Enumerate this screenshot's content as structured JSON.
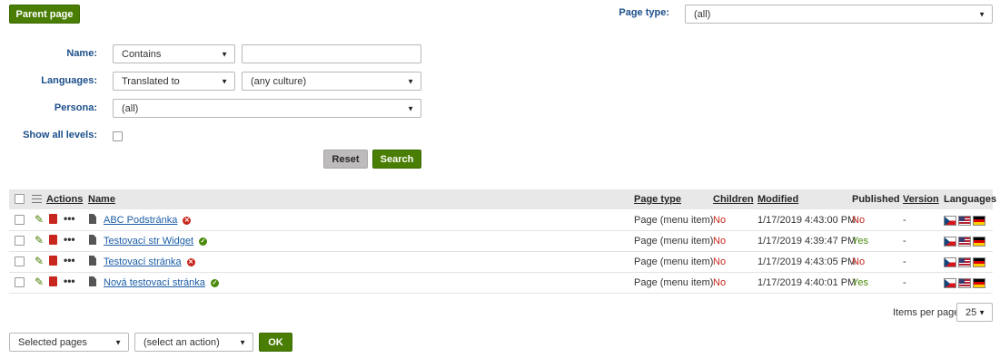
{
  "toolbar": {
    "parent_page_label": "Parent page"
  },
  "page_type_filter": {
    "label": "Page type:",
    "value": "(all)"
  },
  "filters": {
    "name_label": "Name:",
    "name_operator": "Contains",
    "name_value": "",
    "languages_label": "Languages:",
    "languages_operator": "Translated to",
    "languages_culture": "(any culture)",
    "persona_label": "Persona:",
    "persona_value": "(all)",
    "show_all_levels_label": "Show all levels:",
    "reset_label": "Reset",
    "search_label": "Search"
  },
  "grid": {
    "headers": {
      "actions": "Actions",
      "name": "Name",
      "page_type": "Page type",
      "children": "Children",
      "modified": "Modified",
      "published": "Published",
      "version": "Version",
      "languages": "Languages"
    },
    "rows": [
      {
        "name": "ABC Podstránka",
        "status": "error",
        "page_type": "Page (menu item)",
        "children": "No",
        "modified": "1/17/2019 4:43:00 PM",
        "published": "No",
        "version": "-"
      },
      {
        "name": "Testovací str Widget",
        "status": "ok",
        "page_type": "Page (menu item)",
        "children": "No",
        "modified": "1/17/2019 4:39:47 PM",
        "published": "Yes",
        "version": "-"
      },
      {
        "name": "Testovací stránka",
        "status": "error",
        "page_type": "Page (menu item)",
        "children": "No",
        "modified": "1/17/2019 4:43:05 PM",
        "published": "No",
        "version": "-"
      },
      {
        "name": "Nová testovací stránka",
        "status": "ok",
        "page_type": "Page (menu item)",
        "children": "No",
        "modified": "1/17/2019 4:40:01 PM",
        "published": "Yes",
        "version": "-"
      }
    ],
    "language_flags": [
      "czech-flag-icon",
      "us-flag-icon",
      "german-flag-icon"
    ]
  },
  "pager": {
    "items_per_page_label": "Items per page",
    "items_per_page_value": "25"
  },
  "mass_action": {
    "scope_value": "Selected pages",
    "action_value": "(select an action)",
    "ok_label": "OK"
  },
  "colors": {
    "accent_green": "#497d04",
    "label_blue": "#1c4f8a",
    "link_blue": "#1c5ea6",
    "no_red": "#c7271e",
    "yes_green": "#4a8a0a"
  }
}
